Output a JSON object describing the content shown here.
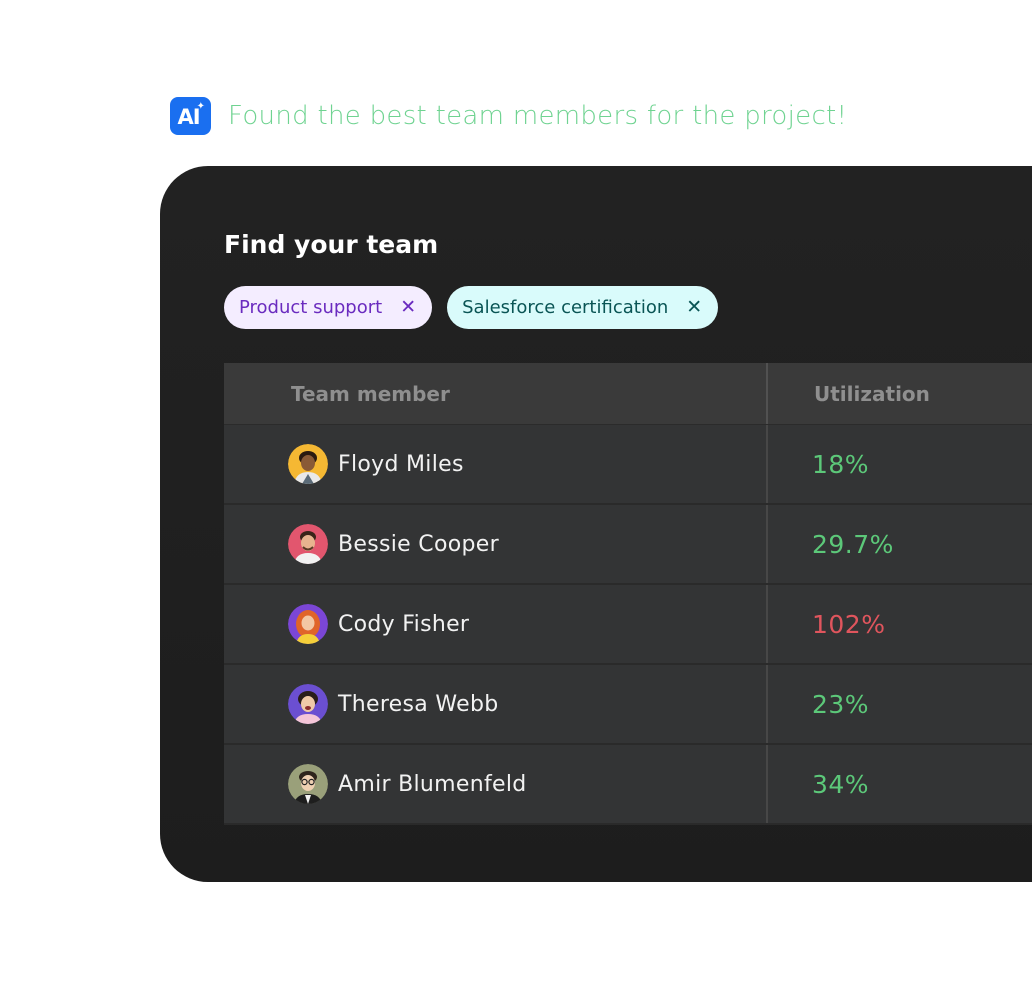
{
  "banner": {
    "badge_label": "AI",
    "message": "Found the best team members for the project!",
    "accent": "#1a6ff0",
    "message_color": "#6fd391"
  },
  "panel": {
    "title": "Find your team",
    "filters": [
      {
        "label": "Product support",
        "icon": "close-icon",
        "color": "#f4edff"
      },
      {
        "label": "Salesforce certification",
        "icon": "close-icon",
        "color": "#d9fbfb"
      }
    ]
  },
  "table": {
    "columns": [
      "Team member",
      "Utilization"
    ],
    "rows": [
      {
        "name": "Floyd Miles",
        "utilization": "18%",
        "status": "good"
      },
      {
        "name": "Bessie Cooper",
        "utilization": "29.7%",
        "status": "good"
      },
      {
        "name": "Cody Fisher",
        "utilization": "102%",
        "status": "over"
      },
      {
        "name": "Theresa Webb",
        "utilization": "23%",
        "status": "good"
      },
      {
        "name": "Amir Blumenfeld",
        "utilization": "34%",
        "status": "good"
      }
    ]
  },
  "colors": {
    "good": "#5cc879",
    "over": "#e0555d"
  }
}
